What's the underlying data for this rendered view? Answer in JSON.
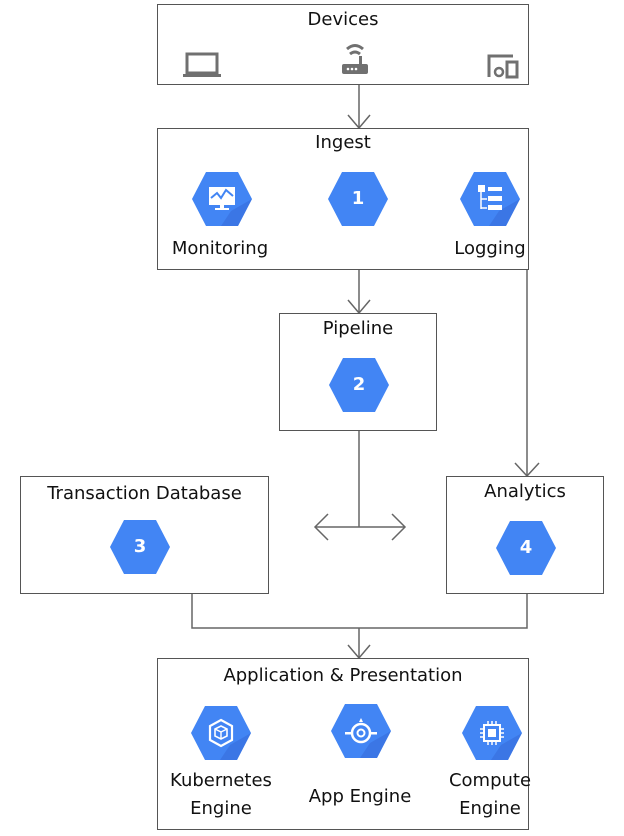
{
  "colors": {
    "hex_fill": "#4285f4",
    "hex_shadow": "#3367d6",
    "line": "#666666",
    "device_icon": "#707070"
  },
  "devices": {
    "title": "Devices",
    "icons": [
      "laptop-icon",
      "wifi-router-icon",
      "devices-icon"
    ]
  },
  "ingest": {
    "title": "Ingest",
    "items": [
      {
        "label": "Monitoring",
        "icon": "monitoring-icon"
      },
      {
        "label": "",
        "number": "1"
      },
      {
        "label": "Logging",
        "icon": "logging-icon"
      }
    ]
  },
  "pipeline": {
    "title": "Pipeline",
    "number": "2"
  },
  "transaction_db": {
    "title": "Transaction Database",
    "number": "3"
  },
  "analytics": {
    "title": "Analytics",
    "number": "4"
  },
  "app": {
    "title": "Application & Presentation",
    "items": [
      {
        "label_line1": "Kubernetes",
        "label_line2": "Engine",
        "icon": "kubernetes-engine-icon"
      },
      {
        "label_line1": "App Engine",
        "label_line2": "",
        "icon": "app-engine-icon"
      },
      {
        "label_line1": "Compute",
        "label_line2": "Engine",
        "icon": "compute-engine-icon"
      }
    ]
  }
}
